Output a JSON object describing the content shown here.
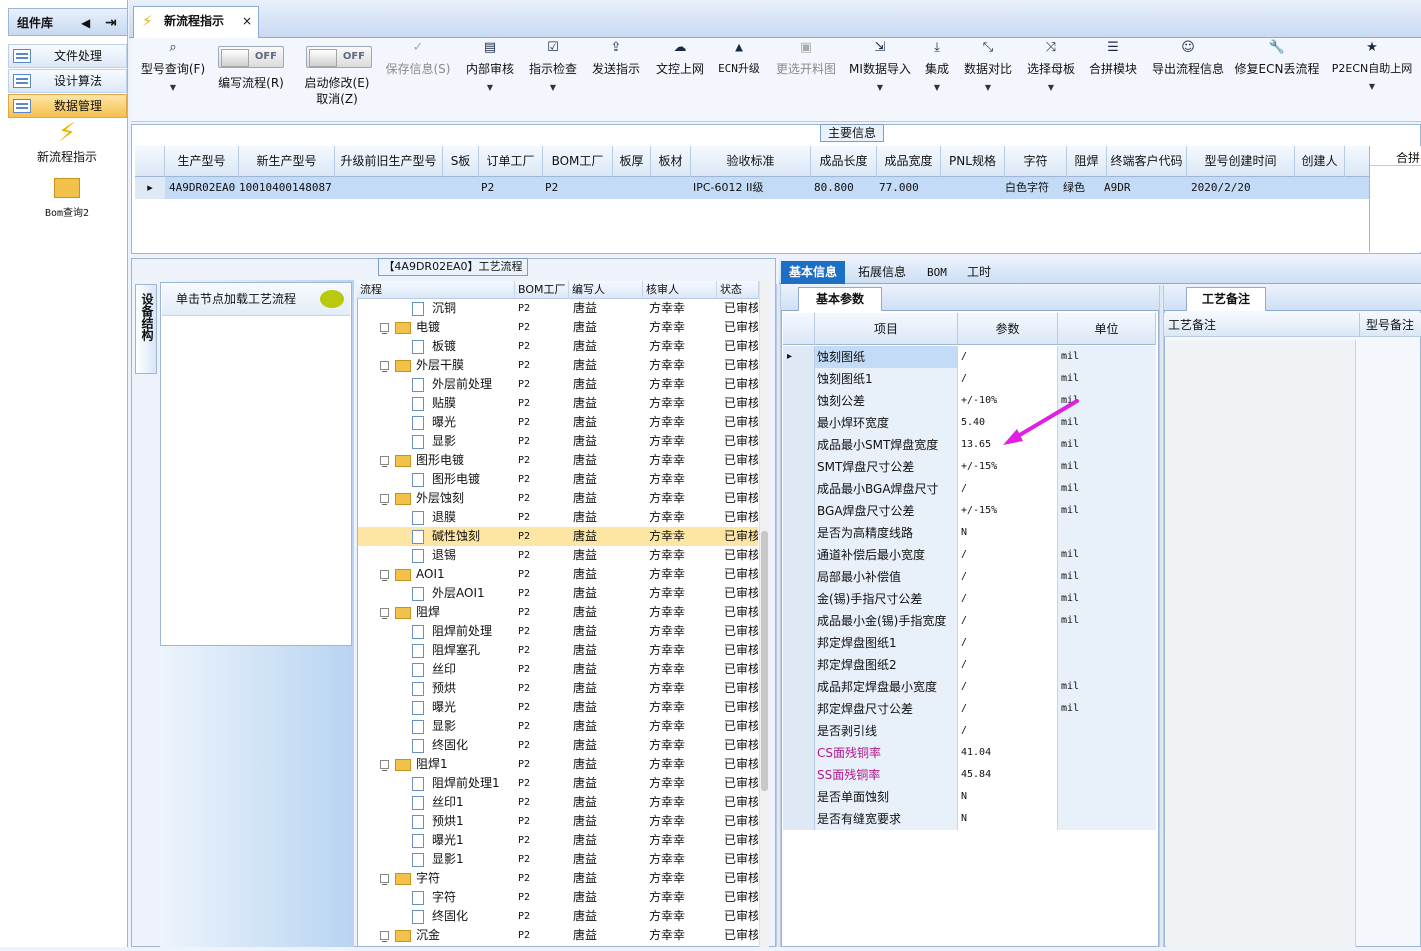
{
  "left_panel": {
    "title": "组件库",
    "nav": [
      "文件处理",
      "设计算法",
      "数据管理"
    ],
    "items": [
      {
        "label": "新流程指示",
        "icon": "lightning-icon"
      },
      {
        "label": "Bom查询2",
        "icon": "folder-open-icon"
      }
    ]
  },
  "tab": {
    "title": "新流程指示",
    "close": "×"
  },
  "toolbar": {
    "model_query": "型号查询(F)",
    "write_flow": "编写流程(R)",
    "toggle_off": "OFF",
    "start_modify": "启动修改(E)",
    "cancel": "取消(Z)",
    "buttons": [
      "保存信息(S)",
      "内部审核",
      "指示检查",
      "发送指示",
      "文控上网",
      "ECN升级",
      "更选开料图",
      "MI数据导入",
      "集成",
      "数据对比",
      "选择母板",
      "合拼模块",
      "导出流程信息",
      "修复ECN丢流程",
      "P2ECN自助上网"
    ]
  },
  "main_info": {
    "title": "主要信息",
    "columns": [
      "生产型号",
      "新生产型号",
      "升级前旧生产型号",
      "S板",
      "订单工厂",
      "BOM工厂",
      "板厚",
      "板材",
      "验收标准",
      "成品长度",
      "成品宽度",
      "PNL规格",
      "字符",
      "阻焊",
      "终端客户代码",
      "型号创建时间",
      "创建人"
    ],
    "row": [
      "4A9DR02EA0",
      "10010400148087",
      "",
      "",
      "P2",
      "P2",
      "",
      "",
      "IPC-6012 II级",
      "80.800",
      "77.000",
      "",
      "白色字符",
      "绿色",
      "A9DR",
      "2020/2/20",
      ""
    ],
    "right_stub": "合拼"
  },
  "process": {
    "title": "【4A9DR02EA0】工艺流程",
    "vertical_tab": "设备结构",
    "click_hint": "单击节点加载工艺流程",
    "columns": [
      "流程",
      "BOM工厂",
      "编写人",
      "核审人",
      "状态"
    ],
    "rows": [
      {
        "name": "沉铜",
        "level": 1,
        "type": "leaf"
      },
      {
        "name": "电镀",
        "level": 0,
        "type": "folder"
      },
      {
        "name": "板镀",
        "level": 1,
        "type": "leaf"
      },
      {
        "name": "外层干膜",
        "level": 0,
        "type": "folder"
      },
      {
        "name": "外层前处理",
        "level": 1,
        "type": "leaf"
      },
      {
        "name": "贴膜",
        "level": 1,
        "type": "leaf"
      },
      {
        "name": "曝光",
        "level": 1,
        "type": "leaf"
      },
      {
        "name": "显影",
        "level": 1,
        "type": "leaf"
      },
      {
        "name": "图形电镀",
        "level": 0,
        "type": "folder"
      },
      {
        "name": "图形电镀",
        "level": 1,
        "type": "leaf"
      },
      {
        "name": "外层蚀刻",
        "level": 0,
        "type": "folder"
      },
      {
        "name": "退膜",
        "level": 1,
        "type": "leaf"
      },
      {
        "name": "碱性蚀刻",
        "level": 1,
        "type": "leaf",
        "selected": true
      },
      {
        "name": "退锡",
        "level": 1,
        "type": "leaf"
      },
      {
        "name": "AOI1",
        "level": 0,
        "type": "folder"
      },
      {
        "name": "外层AOI1",
        "level": 1,
        "type": "leaf"
      },
      {
        "name": "阻焊",
        "level": 0,
        "type": "folder"
      },
      {
        "name": "阻焊前处理",
        "level": 1,
        "type": "leaf"
      },
      {
        "name": "阻焊塞孔",
        "level": 1,
        "type": "leaf"
      },
      {
        "name": "丝印",
        "level": 1,
        "type": "leaf"
      },
      {
        "name": "预烘",
        "level": 1,
        "type": "leaf"
      },
      {
        "name": "曝光",
        "level": 1,
        "type": "leaf"
      },
      {
        "name": "显影",
        "level": 1,
        "type": "leaf"
      },
      {
        "name": "终固化",
        "level": 1,
        "type": "leaf"
      },
      {
        "name": "阻焊1",
        "level": 0,
        "type": "folder"
      },
      {
        "name": "阻焊前处理1",
        "level": 1,
        "type": "leaf"
      },
      {
        "name": "丝印1",
        "level": 1,
        "type": "leaf"
      },
      {
        "name": "预烘1",
        "level": 1,
        "type": "leaf"
      },
      {
        "name": "曝光1",
        "level": 1,
        "type": "leaf"
      },
      {
        "name": "显影1",
        "level": 1,
        "type": "leaf"
      },
      {
        "name": "字符",
        "level": 0,
        "type": "folder"
      },
      {
        "name": "字符",
        "level": 1,
        "type": "leaf"
      },
      {
        "name": "终固化",
        "level": 1,
        "type": "leaf"
      },
      {
        "name": "沉金",
        "level": 0,
        "type": "folder"
      }
    ],
    "bom_factory": "P2",
    "writer": "唐益",
    "reviewer": "方幸幸",
    "status": "已审核"
  },
  "right_tabs": [
    "基本信息",
    "拓展信息",
    "BOM",
    "工时"
  ],
  "basic_params": {
    "tab": "基本参数",
    "columns": [
      "项目",
      "参数",
      "单位"
    ],
    "rows": [
      {
        "item": "蚀刻图纸",
        "value": "/",
        "unit": "mil"
      },
      {
        "item": "蚀刻图纸1",
        "value": "/",
        "unit": "mil"
      },
      {
        "item": "蚀刻公差",
        "value": "+/-10%",
        "unit": "mil"
      },
      {
        "item": "最小焊环宽度",
        "value": "5.40",
        "unit": "mil"
      },
      {
        "item": "成品最小SMT焊盘宽度",
        "value": "13.65",
        "unit": "mil"
      },
      {
        "item": "SMT焊盘尺寸公差",
        "value": "+/-15%",
        "unit": "mil"
      },
      {
        "item": "成品最小BGA焊盘尺寸",
        "value": "/",
        "unit": "mil"
      },
      {
        "item": "BGA焊盘尺寸公差",
        "value": "+/-15%",
        "unit": "mil"
      },
      {
        "item": "是否为高精度线路",
        "value": "N",
        "unit": ""
      },
      {
        "item": "通道补偿后最小宽度",
        "value": "/",
        "unit": "mil"
      },
      {
        "item": "局部最小补偿值",
        "value": "/",
        "unit": "mil"
      },
      {
        "item": "金(锡)手指尺寸公差",
        "value": "/",
        "unit": "mil"
      },
      {
        "item": "成品最小金(锡)手指宽度",
        "value": "/",
        "unit": "mil"
      },
      {
        "item": "邦定焊盘图纸1",
        "value": "/",
        "unit": ""
      },
      {
        "item": "邦定焊盘图纸2",
        "value": "/",
        "unit": ""
      },
      {
        "item": "成品邦定焊盘最小宽度",
        "value": "/",
        "unit": "mil"
      },
      {
        "item": "邦定焊盘尺寸公差",
        "value": "/",
        "unit": "mil"
      },
      {
        "item": "是否剥引线",
        "value": "/",
        "unit": ""
      },
      {
        "item": "CS面残铜率",
        "value": "41.04",
        "unit": "",
        "pink": true
      },
      {
        "item": "SS面残铜率",
        "value": "45.84",
        "unit": "",
        "pink": true
      },
      {
        "item": "是否单面蚀刻",
        "value": "N",
        "unit": ""
      },
      {
        "item": "是否有缝宽要求",
        "value": "N",
        "unit": ""
      }
    ]
  },
  "remarks": {
    "tab": "工艺备注",
    "col1": "工艺备注",
    "col2": "型号备注"
  },
  "colors": {
    "accent": "#1d6fc4",
    "selection": "#fde5a3",
    "annotation_arrow": "#e020e0"
  }
}
